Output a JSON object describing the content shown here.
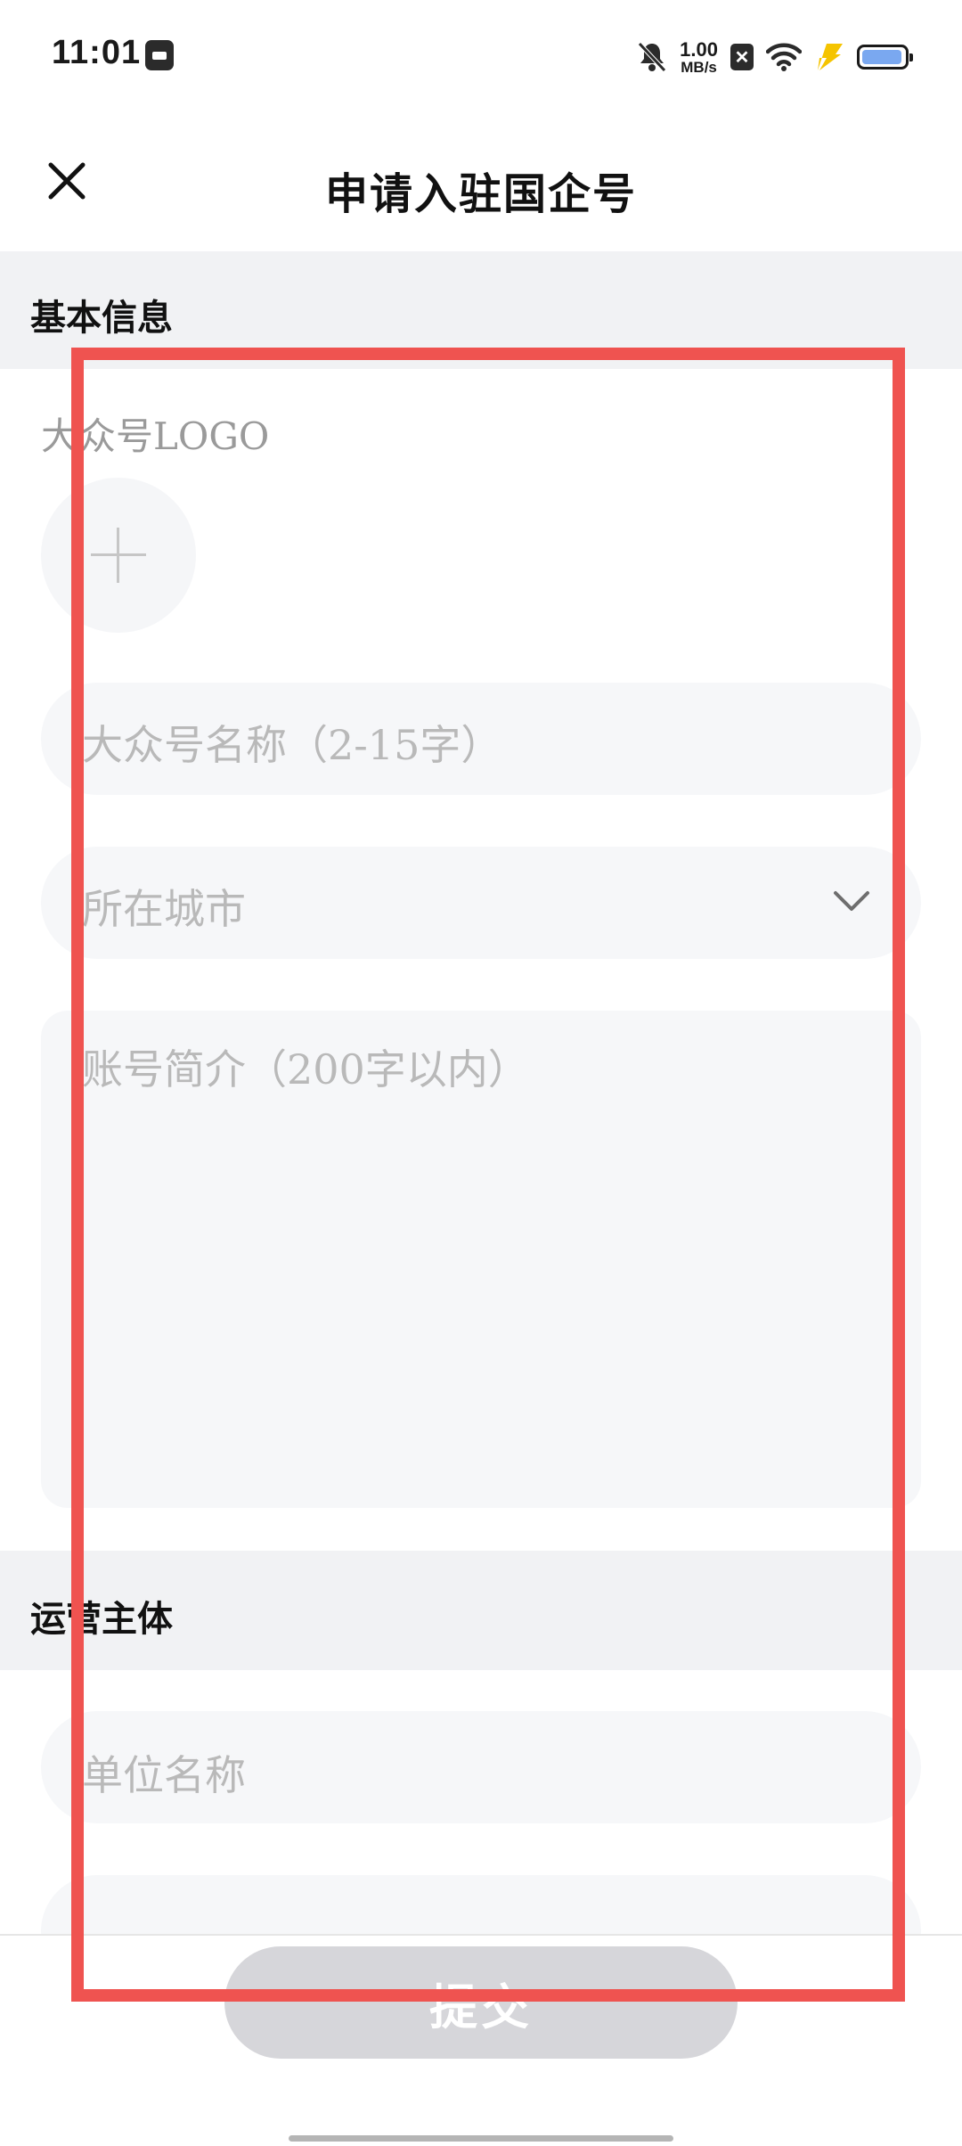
{
  "status_bar": {
    "time": "11:01",
    "net_speed_value": "1.00",
    "net_speed_unit": "MB/s",
    "sim_badge": "✕",
    "battery_level": 0.95,
    "charging_color": "#f5c400",
    "battery_color": "#7aa8f0"
  },
  "header": {
    "title": "申请入驻国企号",
    "close_icon": "close-icon"
  },
  "sections": {
    "basic_info": "基本信息",
    "operator": "运营主体"
  },
  "form": {
    "logo_label": "大众号LOGO",
    "logo_add_icon": "plus-icon",
    "name_placeholder": "大众号名称（2-15字）",
    "city_placeholder": "所在城市",
    "city_dropdown_icon": "chevron-down-icon",
    "intro_placeholder": "账号简介（200字以内）",
    "org_placeholder": "单位名称"
  },
  "footer": {
    "submit_label": "提交",
    "submit_color": "#d6d6da"
  },
  "overlay": {
    "highlight_color": "#ef5350"
  }
}
